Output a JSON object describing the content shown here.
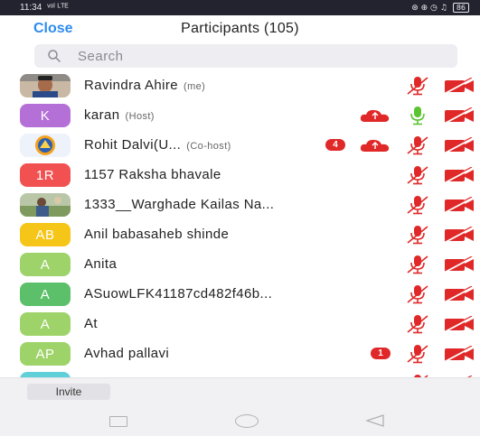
{
  "status_bar": {
    "time": "11:34",
    "signal": "ᵛᵒˡ ᴸᵀᴱ",
    "icons": "⊛ ⊕ ◷ ♫",
    "battery": "86"
  },
  "header": {
    "close_label": "Close",
    "title": "Participants (105)"
  },
  "search": {
    "placeholder": "Search"
  },
  "participants": [
    {
      "name": "Ravindra Ahire",
      "role": "(me)",
      "avatar_type": "photo",
      "avatar_photo": "man-face",
      "badge": "",
      "cloud": false,
      "mic": "muted",
      "video": "off"
    },
    {
      "name": "karan",
      "role": "(Host)",
      "avatar_type": "initials",
      "initials": "K",
      "avatar_color": "#b570d8",
      "badge": "",
      "cloud": true,
      "mic": "on",
      "video": "off"
    },
    {
      "name": "Rohit Dalvi(U...",
      "role": "(Co-host)",
      "avatar_type": "photo",
      "avatar_photo": "logo",
      "badge": "4",
      "cloud": true,
      "mic": "muted",
      "video": "off"
    },
    {
      "name": "1157 Raksha bhavale",
      "role": "",
      "avatar_type": "initials",
      "initials": "1R",
      "avatar_color": "#f25151",
      "badge": "",
      "cloud": false,
      "mic": "muted",
      "video": "off"
    },
    {
      "name": "1333__Warghade Kailas Na...",
      "role": "",
      "avatar_type": "photo",
      "avatar_photo": "outdoor",
      "badge": "",
      "cloud": false,
      "mic": "muted",
      "video": "off"
    },
    {
      "name": "Anil babasaheb shinde",
      "role": "",
      "avatar_type": "initials",
      "initials": "AB",
      "avatar_color": "#f5c518",
      "badge": "",
      "cloud": false,
      "mic": "muted",
      "video": "off"
    },
    {
      "name": "Anita",
      "role": "",
      "avatar_type": "initials",
      "initials": "A",
      "avatar_color": "#9ed36a",
      "badge": "",
      "cloud": false,
      "mic": "muted",
      "video": "off"
    },
    {
      "name": "ASuowLFK41187cd482f46b...",
      "role": "",
      "avatar_type": "initials",
      "initials": "A",
      "avatar_color": "#5cc06a",
      "badge": "",
      "cloud": false,
      "mic": "muted",
      "video": "off"
    },
    {
      "name": "At",
      "role": "",
      "avatar_type": "initials",
      "initials": "A",
      "avatar_color": "#9ed36a",
      "badge": "",
      "cloud": false,
      "mic": "muted",
      "video": "off"
    },
    {
      "name": "Avhad pallavi",
      "role": "",
      "avatar_type": "initials",
      "initials": "AP",
      "avatar_color": "#9ed36a",
      "badge": "1",
      "cloud": false,
      "mic": "muted",
      "video": "off"
    },
    {
      "name": "",
      "role": "",
      "avatar_type": "initials",
      "initials": "",
      "avatar_color": "#5fd0d8",
      "badge": "",
      "cloud": false,
      "mic": "muted",
      "video": "off"
    }
  ],
  "footer": {
    "invite_label": "Invite"
  },
  "colors": {
    "accent": "#2d8cf0",
    "muted_red": "#e02828",
    "mic_on_green": "#5cc430"
  }
}
